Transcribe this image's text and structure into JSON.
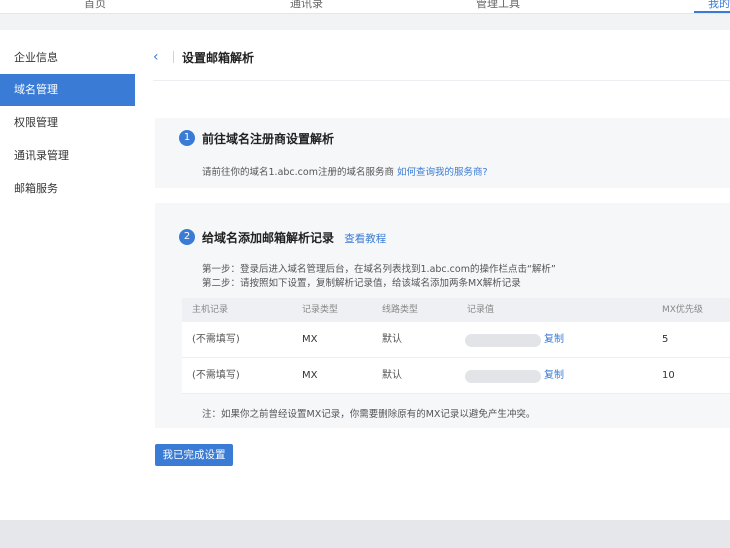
{
  "topnav": {
    "items": [
      "首页",
      "通讯录",
      "管理工具",
      "我的"
    ]
  },
  "sidebar": {
    "items": [
      {
        "label": "企业信息",
        "active": false
      },
      {
        "label": "域名管理",
        "active": true
      },
      {
        "label": "权限管理",
        "active": false
      },
      {
        "label": "通讯录管理",
        "active": false
      },
      {
        "label": "邮箱服务",
        "active": false
      }
    ]
  },
  "page": {
    "back_icon": "‹",
    "title": "设置邮箱解析"
  },
  "step1": {
    "number": "1",
    "title": "前往域名注册商设置解析",
    "desc_prefix": "请前往你的域名1.abc.com注册的域名服务商",
    "desc_link": "如何查询我的服务商?"
  },
  "step2": {
    "number": "2",
    "title": "给域名添加邮箱解析记录",
    "title_link": "查看教程",
    "line1": "第一步：登录后进入域名管理后台，在域名列表找到1.abc.com的操作栏点击“解析”",
    "line2": "第二步：请按照如下设置，复制解析记录值，给该域名添加两条MX解析记录"
  },
  "table": {
    "headers": [
      "主机记录",
      "记录类型",
      "线路类型",
      "记录值",
      "MX优先级"
    ],
    "rows": [
      {
        "host": "(不需填写)",
        "type": "MX",
        "line": "默认",
        "copy": "复制",
        "priority": "5"
      },
      {
        "host": "(不需填写)",
        "type": "MX",
        "line": "默认",
        "copy": "复制",
        "priority": "10"
      }
    ]
  },
  "note": "注：如果你之前曾经设置MX记录，你需要删除原有的MX记录以避免产生冲突。",
  "done_button": "我已完成设置",
  "colors": {
    "accent": "#3a7bd5",
    "card_bg": "#f6f7f9",
    "page_bg": "#f2f3f5"
  }
}
